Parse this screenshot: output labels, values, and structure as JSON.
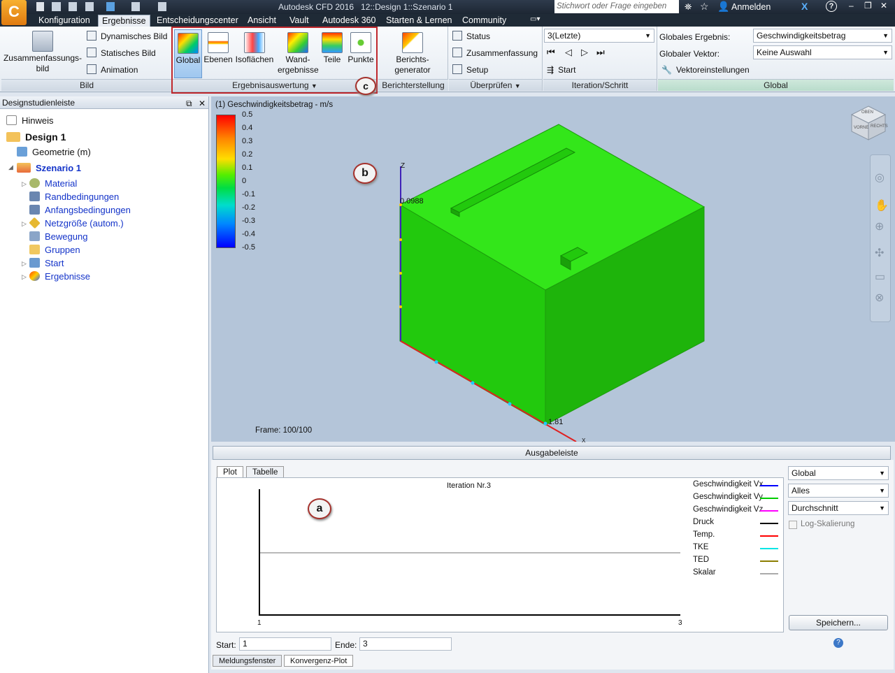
{
  "app": {
    "title": "Autodesk CFD 2016   12::Design 1::Szenario 1",
    "search_placeholder": "Stichwort oder Frage eingeben",
    "signin": "Anmelden",
    "help": "?"
  },
  "tabs": [
    "Konfiguration",
    "Ergebnisse",
    "Entscheidungscenter",
    "Ansicht",
    "Vault",
    "Autodesk 360",
    "Starten & Lernen",
    "Community"
  ],
  "ribbon": {
    "bild": {
      "summary": "Zusammenfassungs-\nbild",
      "dynamic": "Dynamisches Bild",
      "static": "Statisches Bild",
      "animation": "Animation",
      "label": "Bild"
    },
    "ergebnis": {
      "buttons": [
        "Global",
        "Ebenen",
        "Isoflächen",
        "Wand-\nergebnisse",
        "Teile",
        "Punkte"
      ],
      "label": "Ergebnisauswertung"
    },
    "bericht": {
      "button": "Berichts-\ngenerator",
      "label": "Berichterstellung"
    },
    "pruefen": {
      "status": "Status",
      "summary": "Zusammenfassung",
      "setup": "Setup",
      "label": "Überprüfen"
    },
    "iteration": {
      "value": "3(Letzte)",
      "start": "Start",
      "label": "Iteration/Schritt"
    },
    "global": {
      "result_label": "Globales Ergebnis:",
      "result_value": "Geschwindigkeitsbetrag",
      "vector_label": "Globaler Vektor:",
      "vector_value": "Keine Auswahl",
      "vector_settings": "Vektoreinstellungen",
      "label": "Global"
    }
  },
  "callouts": {
    "a": "a",
    "b": "b",
    "c": "c"
  },
  "sidebar": {
    "title": "Designstudienleiste",
    "items": [
      {
        "label": "Hinweis"
      },
      {
        "label": "Design 1"
      },
      {
        "label": "Geometrie (m)"
      },
      {
        "label": "Szenario 1"
      },
      {
        "label": "Material"
      },
      {
        "label": "Randbedingungen"
      },
      {
        "label": "Anfangsbedingungen"
      },
      {
        "label": "Netzgröße (autom.)"
      },
      {
        "label": "Bewegung"
      },
      {
        "label": "Gruppen"
      },
      {
        "label": "Start"
      },
      {
        "label": "Ergebnisse"
      }
    ]
  },
  "viewport": {
    "legend_title": "(1) Geschwindigkeitsbetrag - m/s",
    "scale": [
      "0.5",
      "0.4",
      "0.3",
      "0.2",
      "0.1",
      "0",
      "-0.1",
      "-0.2",
      "-0.3",
      "-0.4",
      "-0.5"
    ],
    "frame": "Frame: 100/100",
    "z_label": "Z",
    "x_label": "X",
    "z_value": "0.0988",
    "x_value": "1.81",
    "viewcube": [
      "OBEN",
      "VORNE",
      "RECHTS"
    ]
  },
  "output": {
    "title": "Ausgabeleiste",
    "tabs": [
      "Plot",
      "Tabelle"
    ],
    "plot_title": "Iteration Nr.3",
    "x_start": "1",
    "x_end": "3",
    "legend": [
      {
        "name": "Geschwindigkeit Vx",
        "color": "#0000ff"
      },
      {
        "name": "Geschwindigkeit Vy",
        "color": "#00cc00"
      },
      {
        "name": "Geschwindigkeit Vz",
        "color": "#ff00ff"
      },
      {
        "name": "Druck",
        "color": "#000000"
      },
      {
        "name": "Temp.",
        "color": "#ff0000"
      },
      {
        "name": "TKE",
        "color": "#00e5e5"
      },
      {
        "name": "TED",
        "color": "#8b7d00"
      },
      {
        "name": "Skalar",
        "color": "#aaaaaa"
      }
    ],
    "selects": [
      "Global",
      "Alles",
      "Durchschnitt"
    ],
    "log_scale": "Log-Skalierung",
    "save": "Speichern...",
    "start_label": "Start:",
    "start_value": "1",
    "end_label": "Ende:",
    "end_value": "3"
  },
  "bottom_tabs": [
    "Meldungsfenster",
    "Konvergenz-Plot"
  ]
}
